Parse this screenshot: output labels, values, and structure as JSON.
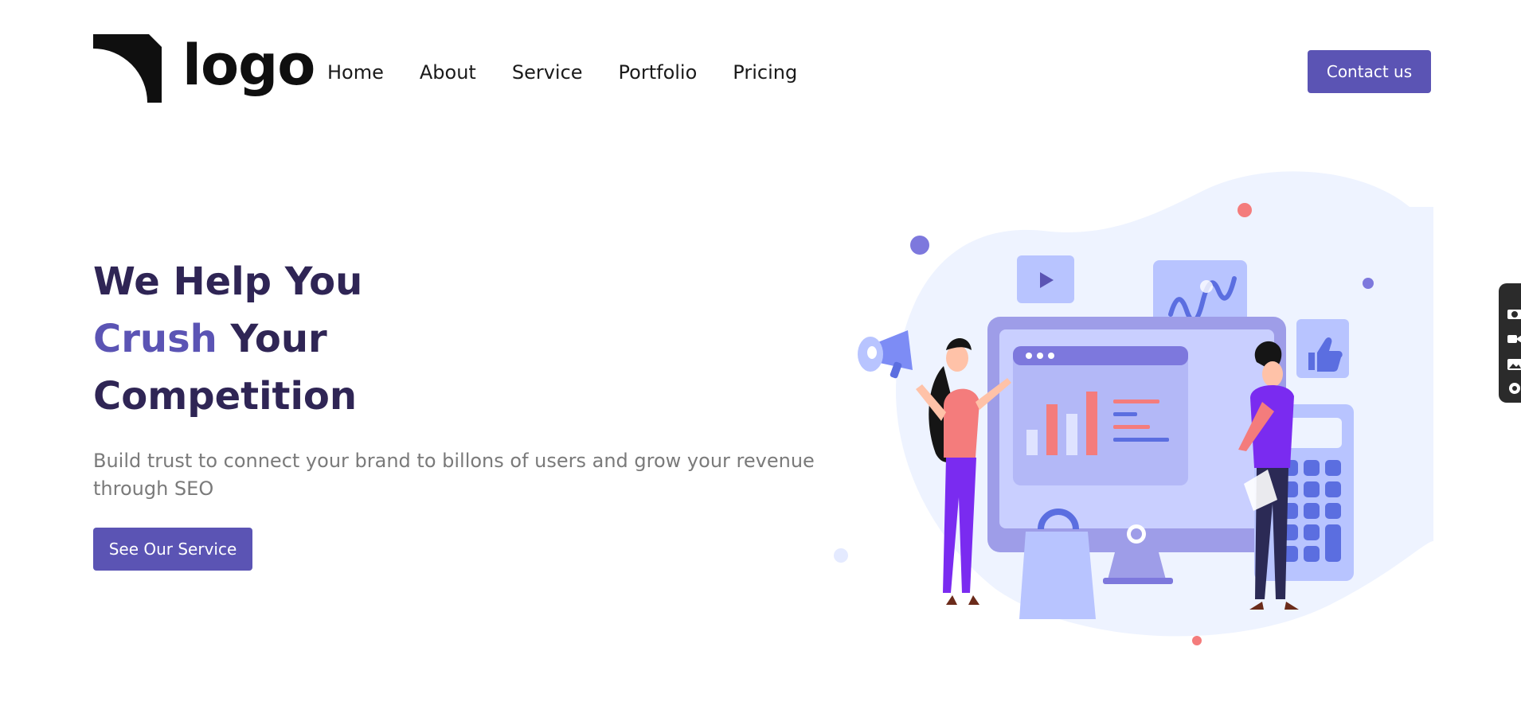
{
  "header": {
    "logo_text": "logo",
    "nav": [
      "Home",
      "About",
      "Service",
      "Portfolio",
      "Pricing"
    ],
    "contact_label": "Contact us"
  },
  "hero": {
    "title_line1": "We Help You",
    "title_accent": "Crush",
    "title_line2_rest": " Your",
    "title_line3": "Competition",
    "description": "Build trust to connect your brand to billons of users and grow your revenue through SEO",
    "cta_label": "See Our Service"
  },
  "colors": {
    "primary": "#5b54b4",
    "heading": "#2f2555",
    "body_text": "#7a7a7a",
    "illustration_bg": "#eef3ff",
    "accent_coral": "#f47c7c"
  },
  "icons": [
    "logo-mark-icon",
    "play-icon",
    "wave-chart-icon",
    "thumbs-up-icon",
    "megaphone-icon",
    "shopping-bag-icon",
    "calculator-icon",
    "camera-icon",
    "video-icon",
    "image-icon",
    "gear-icon"
  ]
}
